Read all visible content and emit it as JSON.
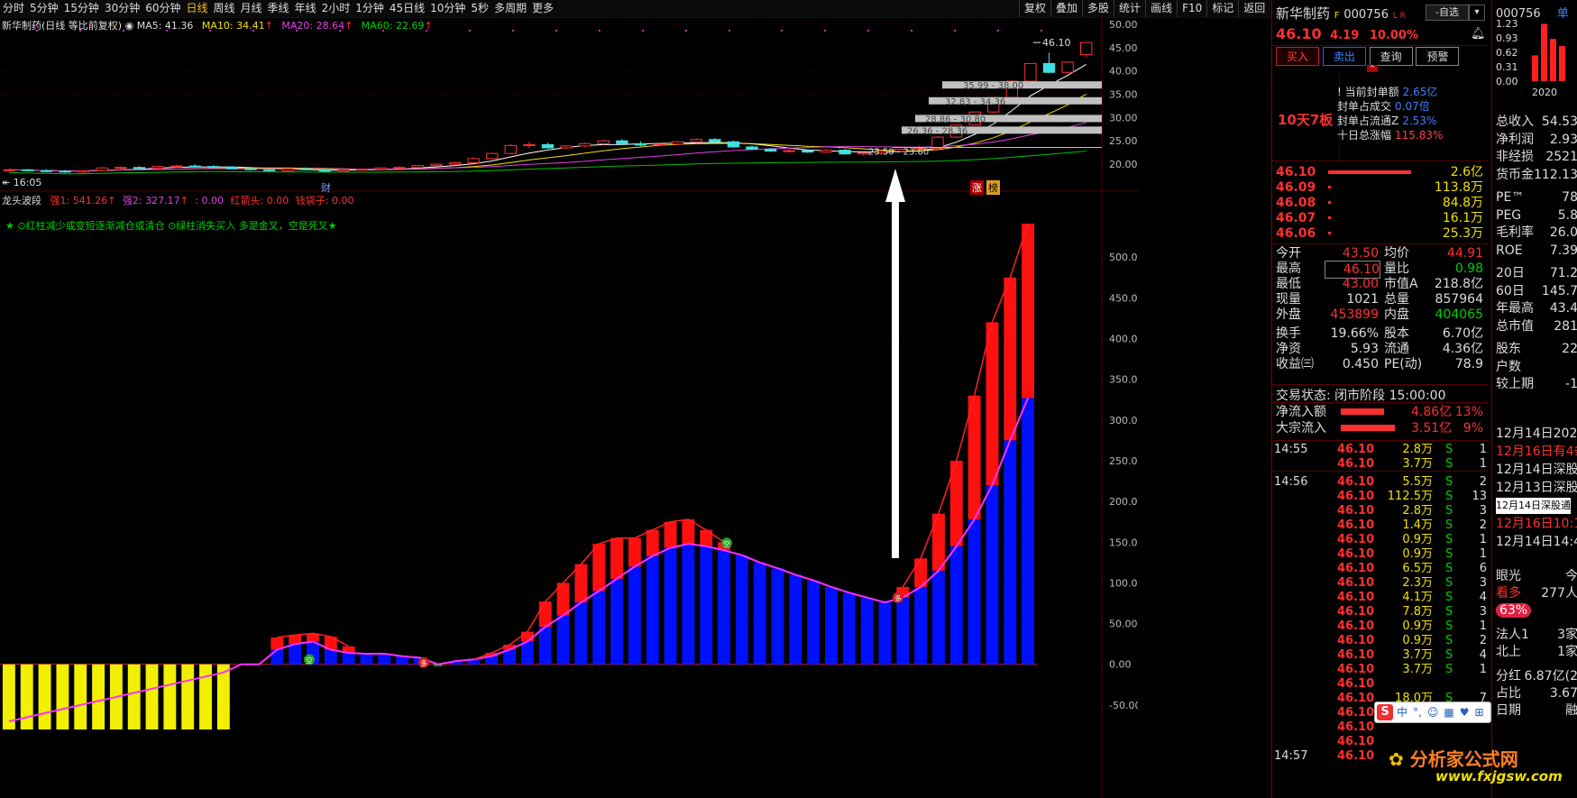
{
  "toolbar": {
    "periods": [
      "分时",
      "5分钟",
      "15分钟",
      "30分钟",
      "60分钟",
      "日线",
      "周线",
      "月线",
      "季线",
      "年线",
      "2小时",
      "1分钟",
      "45日线",
      "10分钟",
      "5秒",
      "多周期",
      "更多"
    ],
    "active": "日线",
    "right": [
      "复权",
      "叠加",
      "多股",
      "统计",
      "画线",
      "F10",
      "标记",
      "返回"
    ]
  },
  "chart_header": {
    "title": "新华制药(日线 等比前复权)",
    "ma5": "MA5: 41.36",
    "ma10": "MA10: 34.41",
    "ma20": "MA20: 28.64",
    "ma60": "MA60: 22.69"
  },
  "price_labels": {
    "last": "46.10",
    "start_time": "16:05",
    "cai": "财",
    "zhang": "涨",
    "bang": "榜",
    "zones": [
      "35.99 - 38.00",
      "32.83 - 34.36",
      "28.86 - 30.80",
      "26.36 - 28.36",
      "23.50 - 23.60"
    ]
  },
  "indicator_header": {
    "name": "龙头波段",
    "q1": "强1: 541.26",
    "q2": "强2: 327.17",
    "c3": ": 0.00",
    "hongjiantou": "红箭头: 0.00",
    "qiandaizi": "钱袋子: 0.00",
    "note": "★ ⊙红柱减少或变短逐渐减仓或清仓  ⊙绿柱消失买入 多是金叉，空是死叉★",
    "marker_duo": "多",
    "marker_kong": "空"
  },
  "chart_data": {
    "type": "bar",
    "price_axis": {
      "ticks": [
        50,
        45,
        40,
        35,
        30,
        25,
        20
      ]
    },
    "indicator_axis": {
      "ticks": [
        500,
        450,
        400,
        350,
        300,
        250,
        200,
        150,
        100,
        50,
        0,
        -50
      ],
      "ylim": [
        -80,
        540
      ]
    },
    "candles": [
      {
        "o": 18.6,
        "h": 19.1,
        "l": 18.3,
        "c": 18.8
      },
      {
        "o": 18.8,
        "h": 19.0,
        "l": 18.5,
        "c": 18.6
      },
      {
        "o": 18.6,
        "h": 18.9,
        "l": 18.3,
        "c": 18.5
      },
      {
        "o": 18.5,
        "h": 18.8,
        "l": 18.1,
        "c": 18.3
      },
      {
        "o": 18.3,
        "h": 18.7,
        "l": 18.0,
        "c": 18.6
      },
      {
        "o": 18.6,
        "h": 19.4,
        "l": 18.5,
        "c": 19.2
      },
      {
        "o": 19.2,
        "h": 19.5,
        "l": 18.9,
        "c": 19.3
      },
      {
        "o": 19.3,
        "h": 19.6,
        "l": 19.0,
        "c": 19.1
      },
      {
        "o": 19.1,
        "h": 19.7,
        "l": 19.0,
        "c": 19.5
      },
      {
        "o": 19.5,
        "h": 19.9,
        "l": 19.3,
        "c": 19.6
      },
      {
        "o": 19.6,
        "h": 20.0,
        "l": 19.4,
        "c": 19.5
      },
      {
        "o": 19.5,
        "h": 19.8,
        "l": 19.2,
        "c": 19.4
      },
      {
        "o": 19.4,
        "h": 19.6,
        "l": 18.9,
        "c": 19.0
      },
      {
        "o": 19.0,
        "h": 19.3,
        "l": 18.6,
        "c": 18.8
      },
      {
        "o": 18.8,
        "h": 19.0,
        "l": 18.4,
        "c": 18.6
      },
      {
        "o": 18.6,
        "h": 19.1,
        "l": 18.5,
        "c": 19.0
      },
      {
        "o": 19.0,
        "h": 19.3,
        "l": 18.7,
        "c": 18.8
      },
      {
        "o": 18.8,
        "h": 19.0,
        "l": 18.3,
        "c": 18.5
      },
      {
        "o": 18.5,
        "h": 18.9,
        "l": 18.4,
        "c": 18.8
      },
      {
        "o": 18.8,
        "h": 19.0,
        "l": 18.6,
        "c": 18.9
      },
      {
        "o": 18.9,
        "h": 19.3,
        "l": 18.7,
        "c": 19.2
      },
      {
        "o": 19.2,
        "h": 19.5,
        "l": 19.0,
        "c": 19.3
      },
      {
        "o": 19.3,
        "h": 19.8,
        "l": 19.2,
        "c": 19.7
      },
      {
        "o": 19.7,
        "h": 20.2,
        "l": 19.5,
        "c": 20.0
      },
      {
        "o": 20.0,
        "h": 20.5,
        "l": 19.8,
        "c": 20.3
      },
      {
        "o": 20.3,
        "h": 21.5,
        "l": 20.2,
        "c": 21.2
      },
      {
        "o": 21.2,
        "h": 22.5,
        "l": 21.0,
        "c": 22.3
      },
      {
        "o": 22.3,
        "h": 24.3,
        "l": 22.1,
        "c": 24.0
      },
      {
        "o": 24.0,
        "h": 24.8,
        "l": 23.5,
        "c": 24.2
      },
      {
        "o": 24.2,
        "h": 24.6,
        "l": 23.3,
        "c": 23.5
      },
      {
        "o": 23.5,
        "h": 24.1,
        "l": 23.2,
        "c": 23.9
      },
      {
        "o": 23.9,
        "h": 24.6,
        "l": 23.6,
        "c": 24.4
      },
      {
        "o": 24.4,
        "h": 25.3,
        "l": 24.1,
        "c": 25.0
      },
      {
        "o": 25.0,
        "h": 25.4,
        "l": 24.2,
        "c": 24.4
      },
      {
        "o": 24.4,
        "h": 24.9,
        "l": 23.8,
        "c": 24.1
      },
      {
        "o": 24.1,
        "h": 24.6,
        "l": 23.7,
        "c": 24.3
      },
      {
        "o": 24.3,
        "h": 25.0,
        "l": 24.0,
        "c": 24.8
      },
      {
        "o": 24.8,
        "h": 25.6,
        "l": 24.5,
        "c": 25.3
      },
      {
        "o": 25.3,
        "h": 25.6,
        "l": 24.6,
        "c": 24.8
      },
      {
        "o": 24.8,
        "h": 25.1,
        "l": 23.5,
        "c": 23.7
      },
      {
        "o": 23.7,
        "h": 24.1,
        "l": 23.0,
        "c": 23.2
      },
      {
        "o": 23.2,
        "h": 23.5,
        "l": 22.6,
        "c": 22.8
      },
      {
        "o": 22.8,
        "h": 23.3,
        "l": 22.5,
        "c": 22.9
      },
      {
        "o": 22.9,
        "h": 23.2,
        "l": 22.4,
        "c": 22.6
      },
      {
        "o": 22.6,
        "h": 23.2,
        "l": 22.4,
        "c": 23.0
      },
      {
        "o": 23.0,
        "h": 23.3,
        "l": 22.0,
        "c": 22.2
      },
      {
        "o": 22.2,
        "h": 22.6,
        "l": 21.9,
        "c": 22.4
      },
      {
        "o": 22.4,
        "h": 23.0,
        "l": 22.3,
        "c": 22.8
      },
      {
        "o": 22.8,
        "h": 23.4,
        "l": 22.6,
        "c": 23.2
      },
      {
        "o": 23.2,
        "h": 24.0,
        "l": 22.9,
        "c": 23.4
      },
      {
        "o": 23.4,
        "h": 26.0,
        "l": 23.3,
        "c": 25.8
      },
      {
        "o": 25.8,
        "h": 28.4,
        "l": 25.6,
        "c": 28.4
      },
      {
        "o": 28.4,
        "h": 31.2,
        "l": 28.4,
        "c": 31.2
      },
      {
        "o": 31.2,
        "h": 34.4,
        "l": 31.0,
        "c": 34.3
      },
      {
        "o": 34.3,
        "h": 38.0,
        "l": 34.2,
        "c": 37.8
      },
      {
        "o": 37.8,
        "h": 41.6,
        "l": 37.7,
        "c": 41.6
      },
      {
        "o": 41.6,
        "h": 43.9,
        "l": 39.5,
        "c": 39.7
      },
      {
        "o": 39.7,
        "h": 42.0,
        "l": 39.5,
        "c": 41.9
      },
      {
        "o": 43.5,
        "h": 46.1,
        "l": 43.0,
        "c": 46.1
      }
    ],
    "histogram": [
      {
        "v": -80,
        "c": "yellow"
      },
      {
        "v": -80,
        "c": "yellow"
      },
      {
        "v": -80,
        "c": "yellow"
      },
      {
        "v": -80,
        "c": "yellow"
      },
      {
        "v": -80,
        "c": "yellow"
      },
      {
        "v": -80,
        "c": "yellow"
      },
      {
        "v": -80,
        "c": "yellow"
      },
      {
        "v": -80,
        "c": "yellow"
      },
      {
        "v": -80,
        "c": "yellow"
      },
      {
        "v": -80,
        "c": "yellow"
      },
      {
        "v": -80,
        "c": "yellow"
      },
      {
        "v": -80,
        "c": "yellow"
      },
      {
        "v": -80,
        "c": "yellow"
      },
      {
        "v": 0,
        "c": "yellow"
      },
      {
        "v": 0,
        "c": "yellow"
      },
      {
        "v": 18,
        "c": "blue",
        "r": 33
      },
      {
        "v": 25,
        "c": "blue",
        "r": 36
      },
      {
        "v": 28,
        "c": "blue",
        "r": 38
      },
      {
        "v": 18,
        "c": "blue",
        "r": 34
      },
      {
        "v": 14,
        "c": "blue",
        "r": 22
      },
      {
        "v": 13,
        "c": "blue"
      },
      {
        "v": 13,
        "c": "blue"
      },
      {
        "v": 10,
        "c": "blue"
      },
      {
        "v": 8,
        "c": "blue"
      },
      {
        "v": 0,
        "c": "green",
        "r": -3
      },
      {
        "v": 4,
        "c": "blue"
      },
      {
        "v": 6,
        "c": "blue",
        "r": 6
      },
      {
        "v": 10,
        "c": "blue",
        "r": 14
      },
      {
        "v": 18,
        "c": "blue",
        "r": 24
      },
      {
        "v": 28,
        "c": "blue",
        "r": 40
      },
      {
        "v": 46,
        "c": "blue",
        "r": 77
      },
      {
        "v": 60,
        "c": "blue",
        "r": 100
      },
      {
        "v": 76,
        "c": "blue",
        "r": 123
      },
      {
        "v": 90,
        "c": "blue",
        "r": 148
      },
      {
        "v": 105,
        "c": "blue",
        "r": 155
      },
      {
        "v": 120,
        "c": "blue",
        "r": 155
      },
      {
        "v": 133,
        "c": "blue",
        "r": 165
      },
      {
        "v": 143,
        "c": "blue",
        "r": 175
      },
      {
        "v": 148,
        "c": "blue",
        "r": 178
      },
      {
        "v": 145,
        "c": "blue",
        "r": 165
      },
      {
        "v": 140,
        "c": "blue",
        "r": 150
      },
      {
        "v": 134,
        "c": "blue"
      },
      {
        "v": 125,
        "c": "blue"
      },
      {
        "v": 118,
        "c": "blue"
      },
      {
        "v": 110,
        "c": "blue"
      },
      {
        "v": 103,
        "c": "blue"
      },
      {
        "v": 95,
        "c": "blue"
      },
      {
        "v": 88,
        "c": "blue"
      },
      {
        "v": 82,
        "c": "blue"
      },
      {
        "v": 76,
        "c": "blue"
      },
      {
        "v": 82,
        "c": "blue",
        "r": 95
      },
      {
        "v": 95,
        "c": "blue",
        "r": 130
      },
      {
        "v": 115,
        "c": "blue",
        "r": 185
      },
      {
        "v": 145,
        "c": "blue",
        "r": 250
      },
      {
        "v": 178,
        "c": "blue",
        "r": 330
      },
      {
        "v": 220,
        "c": "blue",
        "r": 420
      },
      {
        "v": 275,
        "c": "blue",
        "r": 475
      },
      {
        "v": 327,
        "c": "blue",
        "r": 541
      }
    ]
  },
  "quote": {
    "name": "新华制药",
    "code": "000756",
    "lr": "L R",
    "zixuan": "-自选",
    "price": "46.10",
    "change": "4.19",
    "pct": "10.00%",
    "buttons": {
      "buy": "买入",
      "sell": "卖出",
      "query": "查询",
      "alert": "预警"
    },
    "board": "10天7板",
    "fengdan": [
      {
        "k": "当前封单额",
        "v": "2.65亿"
      },
      {
        "k": "封单占成交",
        "v": "0.07倍"
      },
      {
        "k": "封单占流通Z",
        "v": "2.53%"
      },
      {
        "k": "十日总涨幅",
        "v": "115.83%"
      }
    ],
    "book": [
      {
        "p": "46.10",
        "v": "2.6亿"
      },
      {
        "p": "46.09",
        "v": "113.8万"
      },
      {
        "p": "46.08",
        "v": "84.8万"
      },
      {
        "p": "46.07",
        "v": "16.1万"
      },
      {
        "p": "46.06",
        "v": "25.3万"
      }
    ],
    "stats": [
      [
        "今开",
        "43.50",
        "均价",
        "44.91"
      ],
      [
        "最高",
        "46.10",
        "量比",
        "0.98"
      ],
      [
        "最低",
        "43.00",
        "市值A",
        "218.8亿"
      ],
      [
        "现量",
        "1021",
        "总量",
        "857964"
      ],
      [
        "外盘",
        "453899",
        "内盘",
        "404065"
      ],
      [
        "换手",
        "19.66%",
        "股本",
        "6.70亿"
      ],
      [
        "净资",
        "5.93",
        "流通",
        "4.36亿"
      ],
      [
        "收益㈢",
        "0.450",
        "PE(动)",
        "78.9"
      ]
    ],
    "trade_status": "交易状态: 闭市阶段 15:00:00",
    "flow": [
      {
        "k": "净流入额",
        "v": "4.86亿",
        "p": "13%"
      },
      {
        "k": "大宗流入",
        "v": "3.51亿",
        "p": "9%"
      }
    ],
    "ticks": [
      {
        "t": "14:55",
        "p": "46.10",
        "v": "2.8万",
        "s": "S",
        "n": "1"
      },
      {
        "t": "",
        "p": "46.10",
        "v": "3.7万",
        "s": "S",
        "n": "1"
      },
      {
        "t": "14:56",
        "p": "46.10",
        "v": "5.5万",
        "s": "S",
        "n": "2"
      },
      {
        "t": "",
        "p": "46.10",
        "v": "112.5万",
        "s": "S",
        "n": "13"
      },
      {
        "t": "",
        "p": "46.10",
        "v": "2.8万",
        "s": "S",
        "n": "3"
      },
      {
        "t": "",
        "p": "46.10",
        "v": "1.4万",
        "s": "S",
        "n": "2"
      },
      {
        "t": "",
        "p": "46.10",
        "v": "0.9万",
        "s": "S",
        "n": "1"
      },
      {
        "t": "",
        "p": "46.10",
        "v": "0.9万",
        "s": "S",
        "n": "1"
      },
      {
        "t": "",
        "p": "46.10",
        "v": "6.5万",
        "s": "S",
        "n": "6"
      },
      {
        "t": "",
        "p": "46.10",
        "v": "2.3万",
        "s": "S",
        "n": "3"
      },
      {
        "t": "",
        "p": "46.10",
        "v": "4.1万",
        "s": "S",
        "n": "4"
      },
      {
        "t": "",
        "p": "46.10",
        "v": "7.8万",
        "s": "S",
        "n": "3"
      },
      {
        "t": "",
        "p": "46.10",
        "v": "0.9万",
        "s": "S",
        "n": "1"
      },
      {
        "t": "",
        "p": "46.10",
        "v": "0.9万",
        "s": "S",
        "n": "2"
      },
      {
        "t": "",
        "p": "46.10",
        "v": "3.7万",
        "s": "S",
        "n": "4"
      },
      {
        "t": "",
        "p": "46.10",
        "v": "3.7万",
        "s": "S",
        "n": "1"
      },
      {
        "t": "",
        "p": "46.10",
        "v": "",
        "s": "",
        "n": ""
      },
      {
        "t": "",
        "p": "46.10",
        "v": "18.0万",
        "s": "S",
        "n": "7"
      },
      {
        "t": "",
        "p": "46.10",
        "v": "3.7万",
        "s": "S",
        "n": "2"
      },
      {
        "t": "",
        "p": "46.10",
        "v": "",
        "s": "",
        "n": ""
      },
      {
        "t": "",
        "p": "46.10",
        "v": "",
        "s": "",
        "n": ""
      },
      {
        "t": "14:57",
        "p": "46.10",
        "v": "",
        "s": "",
        "n": ""
      }
    ]
  },
  "finance": {
    "code": "000756",
    "more": "单",
    "bar_ticks": [
      "1.23",
      "0.93",
      "0.62",
      "0.31",
      "0.00"
    ],
    "bar_values": [
      0.55,
      1.22,
      0.9,
      0.75
    ],
    "year": "2020",
    "rows": [
      [
        "总收入",
        "54.53"
      ],
      [
        "净利润",
        "2.93"
      ],
      [
        "非经损",
        "2521"
      ],
      [
        "货币金1",
        "12.13"
      ],
      [
        "PE™",
        "78"
      ],
      [
        "PEG",
        "5.8"
      ],
      [
        "毛利率",
        "26.0"
      ],
      [
        "ROE",
        "7.39"
      ],
      [
        "20日",
        "71.2"
      ],
      [
        "60日",
        "145.7"
      ],
      [
        "年最高",
        "43.4"
      ],
      [
        "总市值",
        "281"
      ],
      [
        "股东",
        "22"
      ],
      [
        "户数",
        ""
      ],
      [
        "较上期",
        "-1"
      ]
    ],
    "news": [
      "12月14日2022",
      "12月16日有4条",
      "12月14日深股通",
      "12月13日深股通",
      "12月14日深股通",
      "12月16日10:15",
      "12月14日14:41"
    ],
    "bottom": [
      [
        "眼光",
        "今"
      ],
      [
        "看多",
        "277人"
      ],
      [
        "63%",
        ""
      ],
      [
        "法人1",
        "3家"
      ],
      [
        "北上",
        "1家"
      ],
      [
        "分红",
        "6.87亿(2"
      ],
      [
        "占比",
        "3.67"
      ],
      [
        "日期",
        "融"
      ]
    ]
  },
  "watermark": {
    "site": "分析家公式网",
    "url": "www.fxjgsw.com"
  },
  "ime": {
    "chars": [
      "中",
      "°,",
      "☺",
      "▦",
      "♥",
      "⊞"
    ]
  }
}
